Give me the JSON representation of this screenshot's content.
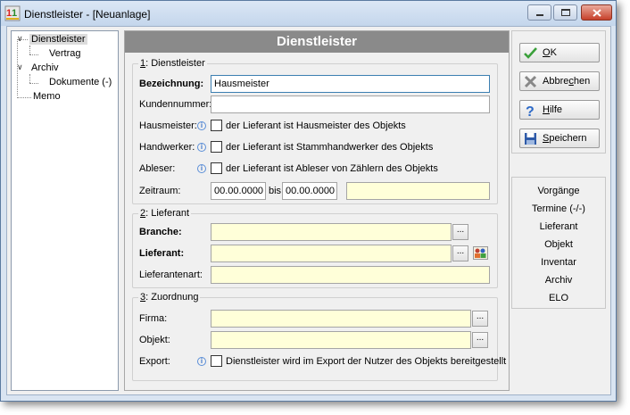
{
  "window": {
    "title": "Dienstleister - [Neuanlage]"
  },
  "tree": {
    "items": [
      {
        "label": "Dienstleister"
      },
      {
        "label": "Vertrag"
      },
      {
        "label": "Archiv"
      },
      {
        "label": "Dokumente (-)"
      },
      {
        "label": "Memo"
      }
    ]
  },
  "main": {
    "header": "Dienstleister",
    "group1": {
      "legend_key": "1",
      "legend_rest": ": Dienstleister",
      "bezeichnung_label": "Bezeichnung:",
      "bezeichnung_value": "Hausmeister",
      "kundennummer_label": "Kundennummer:",
      "kundennummer_value": "",
      "hausmeister_label": "Hausmeister:",
      "hausmeister_text": "der Lieferant ist Hausmeister des Objekts",
      "handwerker_label": "Handwerker:",
      "handwerker_text": "der Lieferant ist Stammhandwerker des Objekts",
      "ableser_label": "Ableser:",
      "ableser_text": "der Lieferant ist Ableser von Zählern des Objekts",
      "zeitraum_label": "Zeitraum:",
      "date_from": "00.00.0000",
      "bis": "bis",
      "date_to": "00.00.0000"
    },
    "group2": {
      "legend_key": "2",
      "legend_rest": ": Lieferant",
      "branche_label": "Branche:",
      "lieferant_label": "Lieferant:",
      "lieferantenart_label": "Lieferantenart:",
      "dots": "..."
    },
    "group3": {
      "legend_key": "3",
      "legend_rest": ": Zuordnung",
      "firma_label": "Firma:",
      "objekt_label": "Objekt:",
      "export_label": "Export:",
      "export_text": "Dienstleister wird im Export der Nutzer des Objekts bereitgestellt"
    }
  },
  "actions": {
    "ok": {
      "pre": "",
      "key": "O",
      "post": "K"
    },
    "cancel": {
      "pre": "Abbre",
      "key": "c",
      "post": "hen"
    },
    "help": {
      "pre": "",
      "key": "H",
      "post": "ilfe"
    },
    "save": {
      "pre": "",
      "key": "S",
      "post": "peichern"
    }
  },
  "links": [
    "Vorgänge",
    "Termine (-/-)",
    "Lieferant",
    "Objekt",
    "Inventar",
    "Archiv",
    "ELO"
  ],
  "colors": {
    "header_bg": "#8a8a8a",
    "required_field_bg": "#ffffd9",
    "window_frame": "#d9e4f1"
  }
}
